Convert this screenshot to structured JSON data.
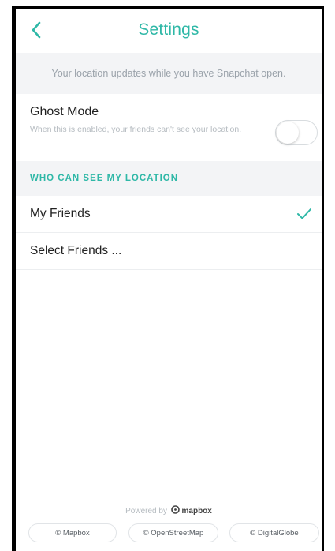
{
  "header": {
    "title": "Settings",
    "back_icon": "chevron-left-icon"
  },
  "info_text": "Your location updates while you have Snapchat open.",
  "ghost_mode": {
    "title": "Ghost Mode",
    "description": "When this is enabled, your friends can't see your location.",
    "enabled": false
  },
  "section": {
    "title": "WHO CAN SEE MY LOCATION"
  },
  "options": [
    {
      "label": "My Friends",
      "selected": true
    },
    {
      "label": "Select Friends ...",
      "selected": false
    }
  ],
  "footer": {
    "powered_by": "Powered by",
    "brand": "mapbox",
    "attributions": [
      "© Mapbox",
      "© OpenStreetMap",
      "© DigitalGlobe"
    ]
  },
  "colors": {
    "accent": "#2fb8a7",
    "band": "#f3f4f6"
  }
}
